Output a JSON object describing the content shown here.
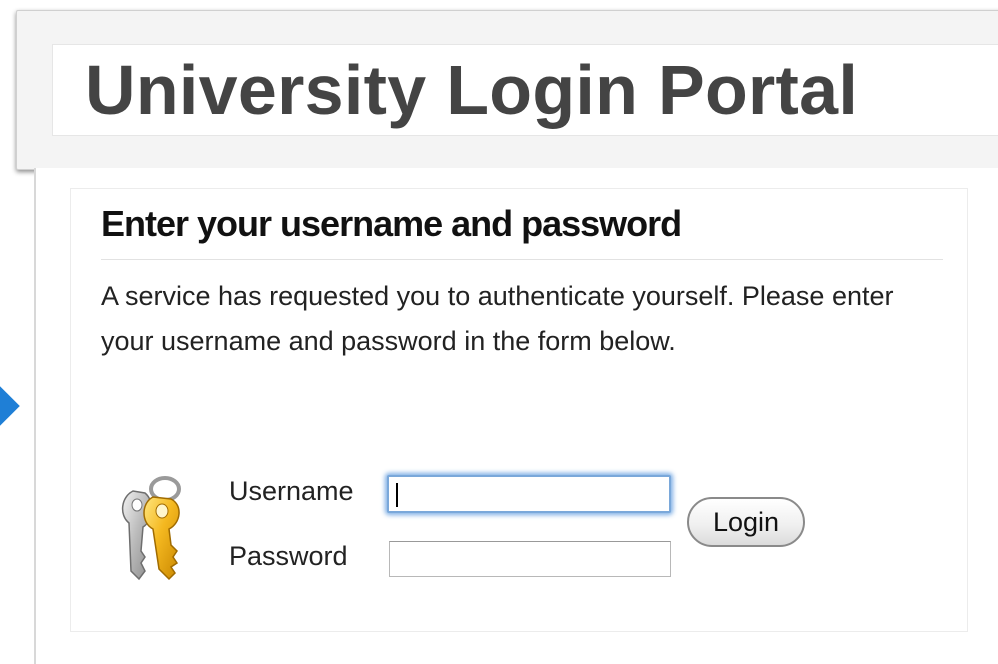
{
  "header": {
    "title": "University Login Portal"
  },
  "login": {
    "heading": "Enter your username and password",
    "intro": "A service has requested you to authenticate yourself. Please enter your username and password in the form below.",
    "username_label": "Username",
    "username_value": "",
    "password_label": "Password",
    "password_value": "",
    "submit_label": "Login"
  },
  "icons": {
    "key": "key-icon",
    "marker": "arrow-marker"
  },
  "colors": {
    "accent": "#1f7fd6",
    "focus_ring": "#7aa8da",
    "title_text": "#444444"
  }
}
